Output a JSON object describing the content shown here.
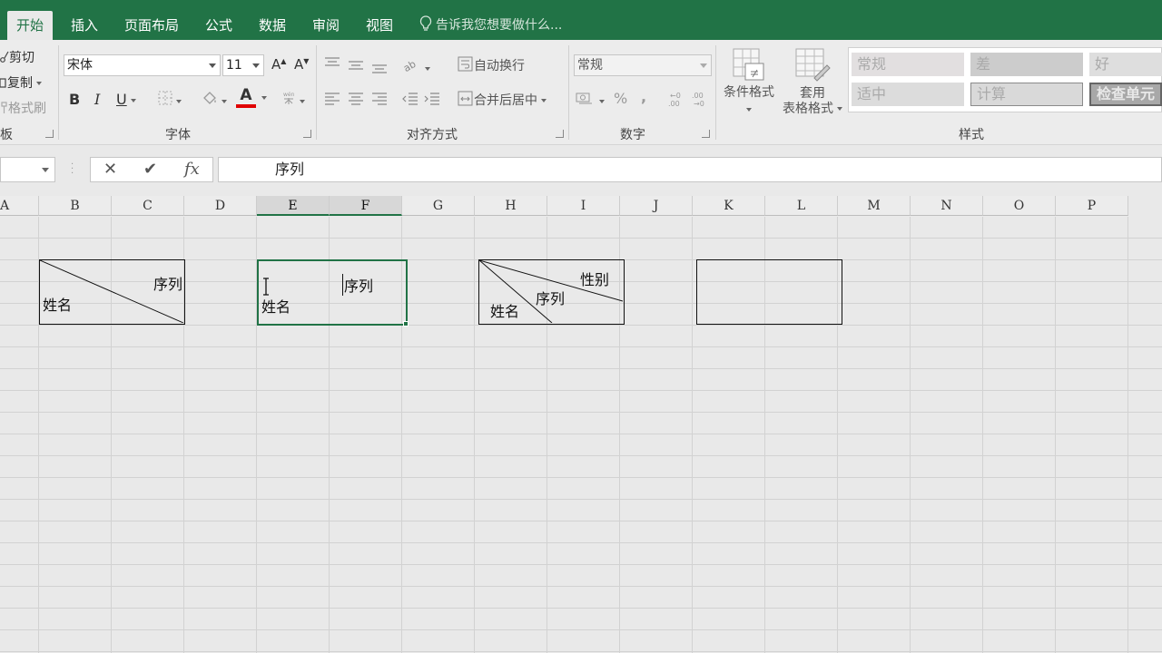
{
  "tabs": [
    {
      "label": "开始",
      "active": true
    },
    {
      "label": "插入"
    },
    {
      "label": "页面布局"
    },
    {
      "label": "公式"
    },
    {
      "label": "数据"
    },
    {
      "label": "审阅"
    },
    {
      "label": "视图"
    }
  ],
  "tell_me": "告诉我您想要做什么...",
  "clipboard": {
    "cut": "剪切",
    "copy": "复制",
    "format_painter": "格式刷",
    "group_label": "板"
  },
  "font": {
    "name": "宋体",
    "size": "11",
    "grow": "A",
    "shrink": "A",
    "bold": "B",
    "italic": "I",
    "underline": "U",
    "color_letter": "A",
    "font_color": "#e00000",
    "group_label": "字体"
  },
  "alignment": {
    "wrap_text": "自动换行",
    "merge_center": "合并后居中",
    "group_label": "对齐方式"
  },
  "number": {
    "format": "常规",
    "percent": "%",
    "comma": ",",
    "group_label": "数字"
  },
  "styles": {
    "conditional": "条件格式",
    "as_table_line1": "套用",
    "as_table_line2": "表格格式",
    "cells": [
      {
        "label": "常规",
        "bg": "#e2dfe0"
      },
      {
        "label": "差",
        "bg": "#cccccc"
      },
      {
        "label": "好",
        "bg": "#dedede"
      },
      {
        "label": "适中",
        "bg": "#dcdcdc"
      },
      {
        "label": "计算",
        "bg": "#d9d9d9"
      },
      {
        "label": "检查单元",
        "bg": "#a8a8a8"
      }
    ],
    "group_label": "样式"
  },
  "formula_bar": {
    "cancel": "✕",
    "enter": "✔",
    "fx": "fx",
    "content": "序列"
  },
  "columns": [
    "A",
    "B",
    "C",
    "D",
    "E",
    "F",
    "G",
    "H",
    "I",
    "J",
    "K",
    "L",
    "M",
    "N",
    "O",
    "P"
  ],
  "selected_columns": [
    "E",
    "F"
  ],
  "cells": {
    "example1": {
      "top_right": "序列",
      "bottom_left": "姓名"
    },
    "example2": {
      "top_right": "序列",
      "bottom_left": "姓名"
    },
    "example3": {
      "top_right": "性别",
      "middle": "序列",
      "bottom_left": "姓名"
    }
  },
  "colors": {
    "accent": "#217346",
    "tabbar": "#217346"
  }
}
